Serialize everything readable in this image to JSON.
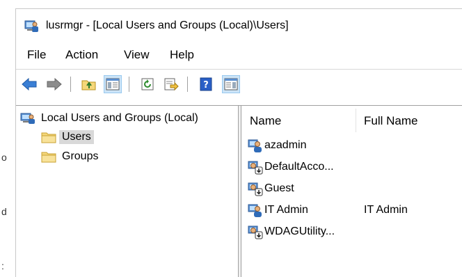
{
  "window": {
    "title": "lusrmgr - [Local Users and Groups (Local)\\Users]"
  },
  "menu": [
    "File",
    "Action",
    "View",
    "Help"
  ],
  "tree": {
    "root": "Local Users and Groups (Local)",
    "children": [
      {
        "label": "Users",
        "selected": true
      },
      {
        "label": "Groups",
        "selected": false
      }
    ]
  },
  "list": {
    "columns": [
      "Name",
      "Full Name"
    ],
    "rows": [
      {
        "name": "azadmin",
        "full_name": "",
        "disabled": false
      },
      {
        "name": "DefaultAcco...",
        "full_name": "",
        "disabled": true
      },
      {
        "name": "Guest",
        "full_name": "",
        "disabled": true
      },
      {
        "name": "IT Admin",
        "full_name": "IT Admin",
        "disabled": false
      },
      {
        "name": "WDAGUtility...",
        "full_name": "",
        "disabled": true
      }
    ]
  },
  "toolbar": {
    "icons": [
      "back-arrow-icon",
      "forward-arrow-icon",
      "up-folder-icon",
      "show-hide-tree-icon",
      "refresh-icon",
      "export-list-icon",
      "help-icon",
      "show-hide-action-pane-icon"
    ]
  },
  "colors": {
    "accent": "#3a7fd5",
    "toolbar_active": "#cce4f7",
    "folder": "#f5d77a",
    "selection": "#d9d9d9"
  },
  "background_fragments": [
    "o",
    "d",
    ":"
  ]
}
